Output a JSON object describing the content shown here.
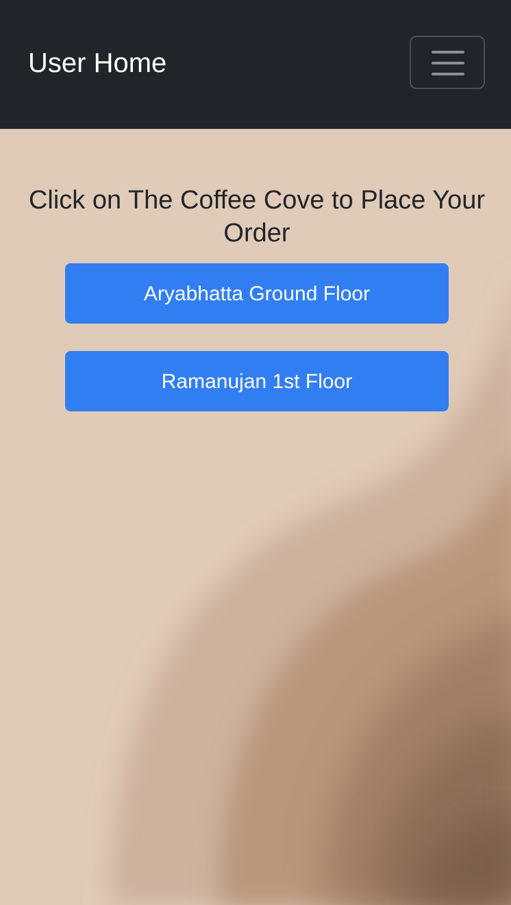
{
  "navbar": {
    "brand": "User Home",
    "toggler_icon": "hamburger-menu-icon"
  },
  "main": {
    "heading": "Click on The Coffee Cove to Place Your Order",
    "buttons": [
      {
        "label": "Aryabhatta Ground Floor"
      },
      {
        "label": "Ramanujan 1st Floor"
      }
    ]
  },
  "colors": {
    "navbar_bg": "#212529",
    "page_bg": "#e0cbb8",
    "button_bg": "#317ef3",
    "button_text": "#ffffff",
    "heading_text": "#212529"
  }
}
